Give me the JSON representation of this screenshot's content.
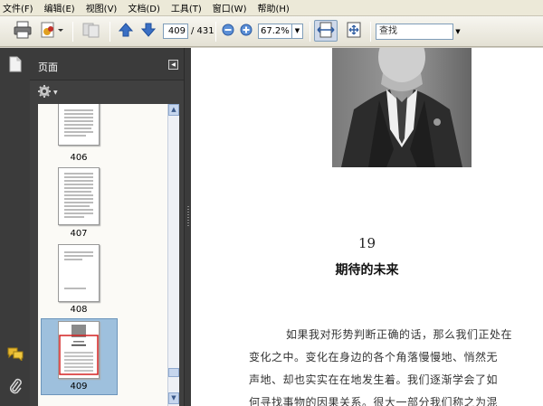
{
  "menu": {
    "items": [
      "文件(F)",
      "编辑(E)",
      "视图(V)",
      "文档(D)",
      "工具(T)",
      "窗口(W)",
      "帮助(H)"
    ]
  },
  "toolbar": {
    "current_page": "409",
    "total_pages": "/ 431",
    "zoom": "67.2%",
    "search_value": "查找"
  },
  "panel": {
    "title": "页面",
    "thumbnails": [
      {
        "label": "406"
      },
      {
        "label": "407"
      },
      {
        "label": "408"
      },
      {
        "label": "409"
      }
    ],
    "selected_page": "409"
  },
  "document": {
    "chapter_number": "19",
    "chapter_title": "期待的未来",
    "paragraph_lines": [
      "如果我对形势判断正确的话，那么我们正处在",
      "变化之中。变化在身边的各个角落慢慢地、悄然无",
      "声地、却也实实在在地发生着。我们逐渐学会了如",
      "何寻找事物的因果关系。很大一部分我们称之为混"
    ]
  },
  "colors": {
    "nav_dark": "#3b3b3b",
    "thumb_selected": "#9ec0dd",
    "arrow_blue": "#3a6fc4",
    "page_bg": "#ffffff"
  }
}
